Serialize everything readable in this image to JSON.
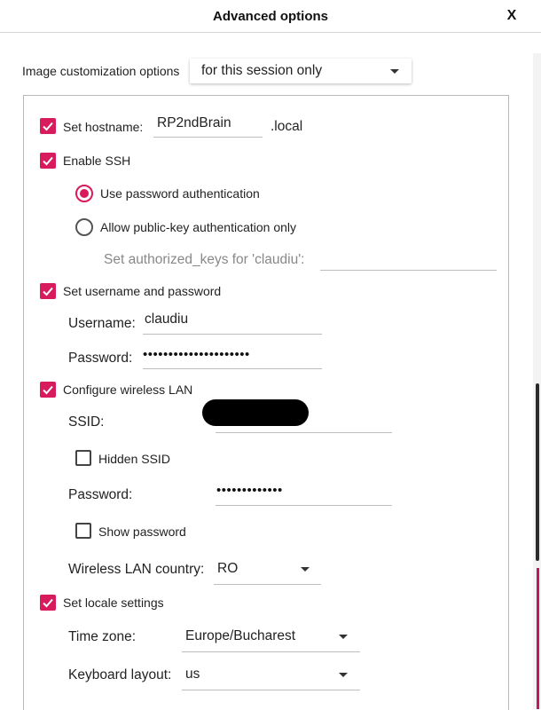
{
  "dialog": {
    "title": "Advanced options",
    "close_label": "X"
  },
  "image_customization": {
    "label": "Image customization options",
    "value": "for this session only"
  },
  "hostname": {
    "checkbox_label": "Set hostname:",
    "value": "RP2ndBrain",
    "suffix": ".local",
    "checked": true
  },
  "ssh": {
    "checkbox_label": "Enable SSH",
    "checked": true,
    "password_auth_label": "Use password authentication",
    "pubkey_auth_label": "Allow public-key authentication only",
    "authorized_keys_label": "Set authorized_keys for 'claudiu':",
    "authorized_keys_value": ""
  },
  "user": {
    "checkbox_label": "Set username and password",
    "checked": true,
    "username_label": "Username:",
    "username_value": "claudiu",
    "password_label": "Password:",
    "password_value": "•••••••••••••••••••••"
  },
  "wifi": {
    "checkbox_label": "Configure wireless LAN",
    "checked": true,
    "ssid_label": "SSID:",
    "hidden_ssid_label": "Hidden SSID",
    "password_label": "Password:",
    "password_value": "•••••••••••••",
    "show_password_label": "Show password",
    "country_label": "Wireless LAN country:",
    "country_value": "RO"
  },
  "locale": {
    "checkbox_label": "Set locale settings",
    "checked": true,
    "timezone_label": "Time zone:",
    "timezone_value": "Europe/Bucharest",
    "keyboard_label": "Keyboard layout:",
    "keyboard_value": "us"
  },
  "colors": {
    "accent": "#d81b5c"
  }
}
